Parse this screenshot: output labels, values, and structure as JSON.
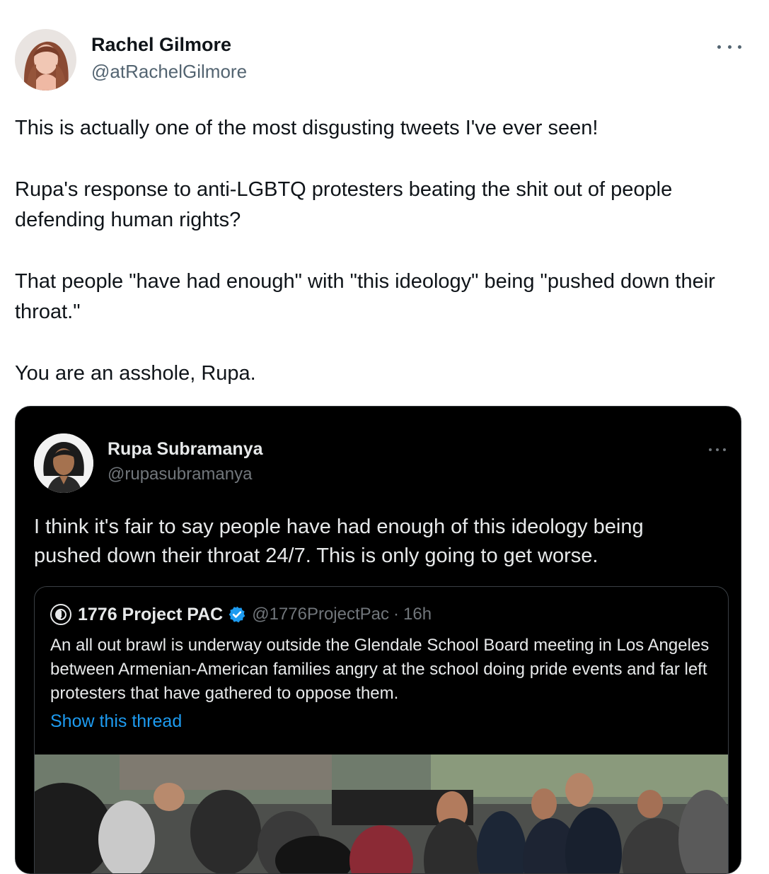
{
  "tweet": {
    "author_name": "Rachel Gilmore",
    "author_handle": "@atRachelGilmore",
    "paragraphs": [
      "This is actually one of the most disgusting tweets I've ever seen!",
      "Rupa's response to anti-LGBTQ protesters beating the shit out of people defending human rights?",
      "That people \"have had enough\" with \"this ideology\" being \"pushed down their throat.\"",
      "You are an asshole, Rupa."
    ],
    "more_icon": "more-horizontal-icon"
  },
  "embedded": {
    "author_name": "Rupa Subramanya",
    "author_handle": "@rupasubramanya",
    "text": "I think it's fair to say people have had enough of this ideology being pushed down their throat 24/7. This is only going to get worse.",
    "more_icon": "more-horizontal-icon",
    "quoted": {
      "author_name": "1776 Project PAC",
      "author_handle": "@1776ProjectPac",
      "separator": "·",
      "time": "16h",
      "text": "An all out brawl is underway outside the Glendale School Board meeting in Los Angeles between Armenian-American families angry at the school doing pride events and far left protesters that have gathered to oppose them.",
      "show_thread": "Show this thread",
      "verified_icon": "verified-badge-icon",
      "colors": {
        "link": "#1d9bf0",
        "verified": "#1d9bf0"
      }
    }
  },
  "colors": {
    "text_primary": "#0f1419",
    "text_secondary": "#536471",
    "dark_bg": "#000000",
    "dark_text": "#e7e9ea",
    "dark_secondary": "#71767b"
  }
}
